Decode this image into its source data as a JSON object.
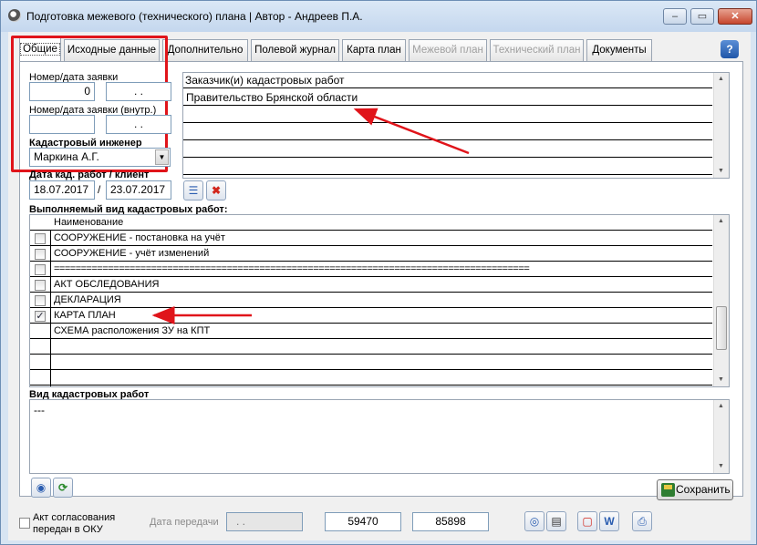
{
  "window": {
    "title": "Подготовка межевого (технического) плана | Автор - Андреев П.А.",
    "min_glyph": "–",
    "max_glyph": "▭",
    "close_glyph": "✕",
    "help_glyph": "?"
  },
  "tabs": [
    {
      "label": "Общие",
      "state": "active"
    },
    {
      "label": "Исходные данные",
      "state": "normal"
    },
    {
      "label": "Дополнительно",
      "state": "normal"
    },
    {
      "label": "Полевой журнал",
      "state": "normal"
    },
    {
      "label": "Карта план",
      "state": "normal"
    },
    {
      "label": "Межевой план",
      "state": "disabled"
    },
    {
      "label": "Технический план",
      "state": "disabled"
    },
    {
      "label": "Документы",
      "state": "normal"
    }
  ],
  "request": {
    "number_label": "Номер/дата заявки",
    "number_value": "0",
    "number_date": " .  .",
    "internal_label": "Номер/дата заявки (внутр.)",
    "internal_value": "",
    "internal_date": " .  .",
    "engineer_label": "Кадастровый инженер",
    "engineer_value": "Маркина А.Г.",
    "dates_label": "Дата кад. работ / клиент",
    "date_work": "18.07.2017",
    "date_sep": "/",
    "date_client": "23.07.2017"
  },
  "customers": {
    "header": "Заказчик(и) кадастровых работ",
    "rows": [
      "Правительство Брянской области",
      "",
      "",
      "",
      ""
    ]
  },
  "works": {
    "section_label": "Выполняемый вид кадастровых работ:",
    "column_header": "Наименование",
    "rows": [
      {
        "checked": false,
        "name": "СООРУЖЕНИЕ - постановка на учёт"
      },
      {
        "checked": false,
        "name": "СООРУЖЕНИЕ - учёт изменений"
      },
      {
        "checked": false,
        "name": "========================================================================================"
      },
      {
        "checked": false,
        "name": "АКТ ОБСЛЕДОВАНИЯ"
      },
      {
        "checked": false,
        "name": "ДЕКЛАРАЦИЯ"
      },
      {
        "checked": true,
        "name": "КАРТА ПЛАН"
      },
      {
        "checked": false,
        "name": "СХЕМА расположения ЗУ на КПТ"
      },
      {
        "checked": null,
        "name": ""
      },
      {
        "checked": null,
        "name": ""
      },
      {
        "checked": null,
        "name": ""
      }
    ]
  },
  "work_type": {
    "label": "Вид кадастровых работ",
    "value": "---"
  },
  "footer": {
    "act_label_line1": "Акт согласования",
    "act_label_line2": "передан в ОКУ",
    "transfer_label": "Дата передачи",
    "transfer_value": " .  .",
    "value_a": "59470",
    "value_b": "85898",
    "save_label": "Сохранить"
  },
  "colors": {
    "annotation_red": "#e0141a",
    "title_bar": "#c4d7ee"
  }
}
